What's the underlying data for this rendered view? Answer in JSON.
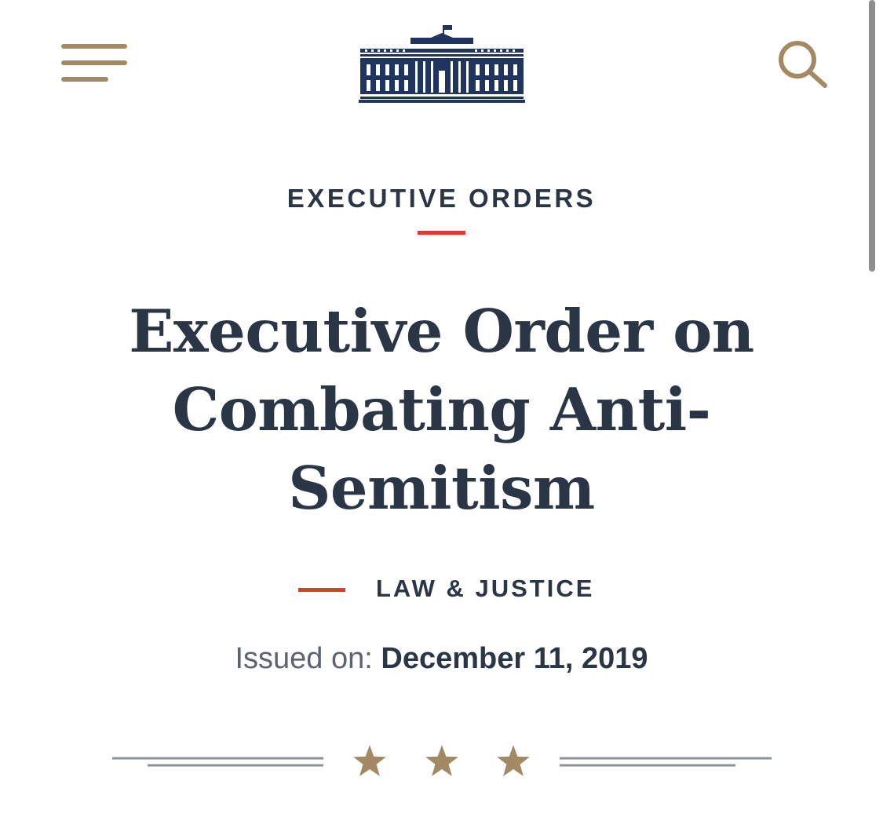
{
  "header": {
    "menu_icon": "hamburger-menu-icon",
    "logo_icon": "white-house-logo-icon",
    "search_icon": "search-icon"
  },
  "article": {
    "category": "EXECUTIVE ORDERS",
    "title": "Executive Order on Combating Anti-Semitism",
    "topic": "LAW & JUSTICE",
    "issued_label": "Issued on:",
    "issued_date": "December 11, 2019"
  },
  "divider": {
    "icon": "star-icon",
    "star_count": 3
  },
  "colors": {
    "navy": "#2a3545",
    "gold": "#a38a64",
    "red_accent": "#d3402e",
    "gray_text": "#5b6370",
    "logo_navy": "#1f3560"
  }
}
